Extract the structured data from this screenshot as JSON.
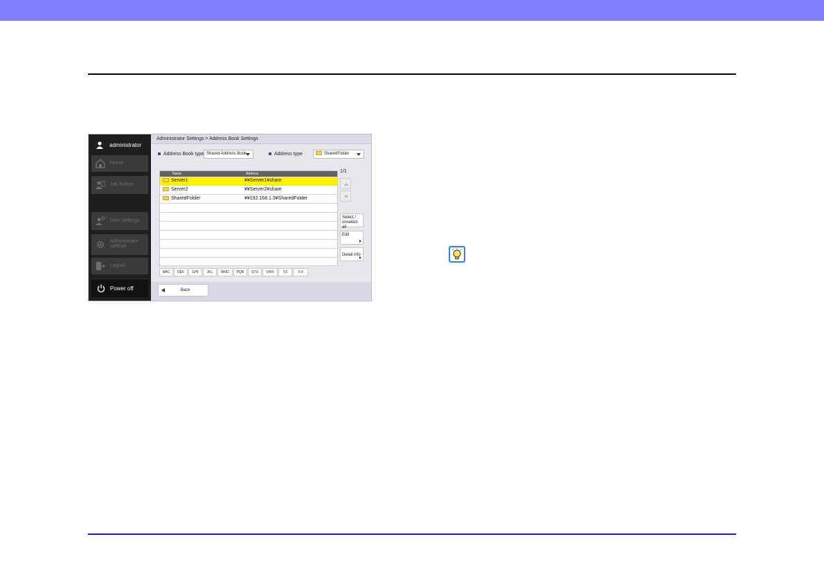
{
  "screen": {
    "breadcrumb": "Administrator Settings > Address Book Settings",
    "sidebar": {
      "user_label": "administrator",
      "items": [
        {
          "label": "Home",
          "icon": "home-icon"
        },
        {
          "label": "Job Button",
          "icon": "job-button-icon"
        },
        {
          "label": "User Settings",
          "icon": "user-settings-icon"
        },
        {
          "label": "Administrator settings",
          "icon": "gear-icon"
        },
        {
          "label": "Logout",
          "icon": "logout-icon"
        }
      ],
      "power_label": "Power off"
    },
    "filters": {
      "address_book_type_label": "Address Book type",
      "address_book_type_value": "Shared Address Book",
      "address_type_label": "Address type",
      "address_type_value": "SharedFolder"
    },
    "table": {
      "headers": [
        "Name",
        "Address"
      ],
      "rows": [
        {
          "name": "Server1",
          "address": "¥¥Server1¥share",
          "selected": true
        },
        {
          "name": "Server2",
          "address": "¥¥Server2¥share",
          "selected": false
        },
        {
          "name": "SharedFolder",
          "address": "¥¥192.168.1.3¥SharedFolder",
          "selected": false
        }
      ]
    },
    "page_indicator": "1/1",
    "actions": {
      "select_label": "Select / unselect all",
      "edit_label": "Edit",
      "detail_label": "Detail info"
    },
    "index_keys": [
      "ABC",
      "DEF",
      "GHI",
      "JKL",
      "MNO",
      "PQR",
      "STU",
      "VWX",
      "YZ",
      "0-9"
    ],
    "back_label": "Back",
    "colors": {
      "header_band": "#8080ff",
      "selected_row": "#fff200",
      "bottom_rule": "#1c1cb4",
      "hint_icon": "#2f86d8"
    }
  },
  "hint_icon_name": "lightbulb-icon"
}
